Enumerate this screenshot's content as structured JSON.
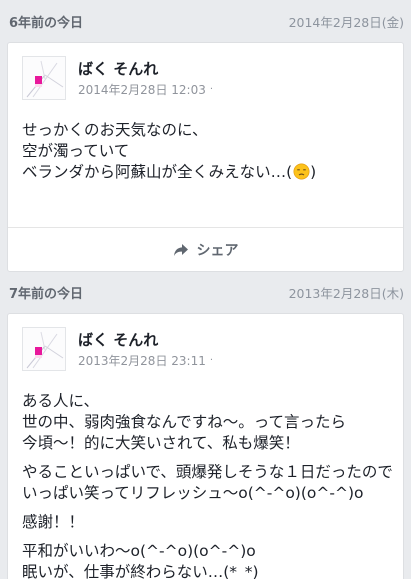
{
  "memories": [
    {
      "heading": "6年前の今日",
      "date": "2014年2月28日(金)",
      "post": {
        "author": "ばく そんれ",
        "timestamp": "2014年2月28日 12:03",
        "dot": "·",
        "lines": [
          "せっかくのお天気なのに、",
          "空が濁っていて",
          "ベランダから阿蘇山が全くみえない…("
        ],
        "line_suffix": ")",
        "emoji": "unamused-face-icon",
        "share_label": "シェア"
      }
    },
    {
      "heading": "7年前の今日",
      "date": "2013年2月28日(木)",
      "post": {
        "author": "ばく そんれ",
        "timestamp": "2013年2月28日 23:11",
        "dot": "·",
        "paragraphs": [
          [
            "ある人に、",
            "世の中、弱肉強食なんですね〜。って言ったら",
            "今頃〜！的に大笑いされて、私も爆笑！"
          ],
          [
            "やることいっぱいで、頭爆発しそうな１日だったので",
            "いっぱい笑ってリフレッシュ〜o(^-^o)(o^-^)o"
          ],
          [
            "感謝！！"
          ],
          [
            "平和がいいわ〜o(^-^o)(o^-^)o",
            "眠いが、仕事が終わらない…(*_*)"
          ]
        ]
      }
    }
  ],
  "colors": {
    "background": "#e9ebee",
    "card": "#ffffff",
    "text": "#1d2129",
    "meta": "#90949c",
    "avatar_accent": "#e8179b"
  }
}
